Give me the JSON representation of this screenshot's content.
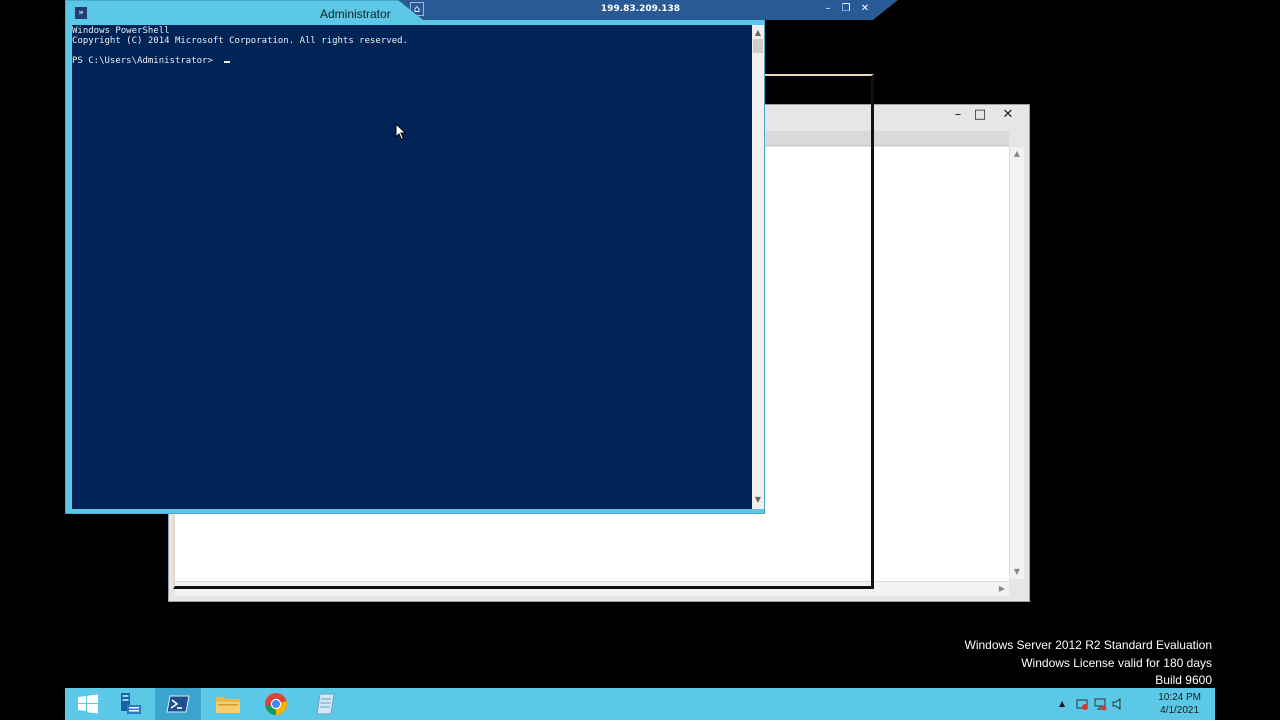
{
  "powershell": {
    "title": "Administrator: Windows PowerShell",
    "title_visible": "Administrator",
    "icon_glyph": "»",
    "console_lines": [
      "Windows PowerShell",
      "Copyright (C) 2014 Microsoft Corporation. All rights reserved.",
      "",
      "PS C:\\Users\\Administrator> "
    ],
    "background_color": "#012456",
    "text_color": "#eeedf0"
  },
  "rdp_bar": {
    "address": "199.83.209.138",
    "pin_glyph": "⌂",
    "minimize_glyph": "–",
    "restore_glyph": "❐",
    "close_glyph": "✕"
  },
  "background_window": {
    "minimize_glyph": "–",
    "maximize_glyph": "□",
    "close_glyph": "✕",
    "scroll_up_glyph": "▲",
    "scroll_down_glyph": "▼",
    "scroll_right_glyph": "▶"
  },
  "watermark": {
    "line1": "Windows Server 2012 R2 Standard Evaluation",
    "line2": "Windows License valid for 180 days",
    "line3": "Build 9600"
  },
  "taskbar": {
    "items": [
      {
        "name": "start",
        "icon": "windows-logo-icon"
      },
      {
        "name": "server-manager",
        "icon": "server-manager-icon"
      },
      {
        "name": "powershell",
        "icon": "powershell-icon",
        "active": true
      },
      {
        "name": "file-explorer",
        "icon": "folder-icon"
      },
      {
        "name": "chrome",
        "icon": "chrome-icon"
      },
      {
        "name": "notepad",
        "icon": "notepad-icon"
      }
    ],
    "tray": {
      "show_hidden_glyph": "▲",
      "time": "10:24 PM",
      "date": "4/1/2021"
    },
    "color": "#5bc8e8"
  }
}
